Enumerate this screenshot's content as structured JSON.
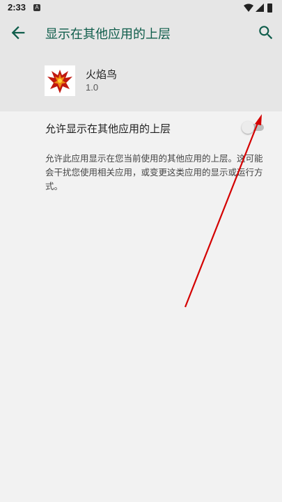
{
  "status_bar": {
    "time": "2:33",
    "notification_glyph": "A",
    "icons": [
      "wifi-icon",
      "signal-icon",
      "battery-icon"
    ]
  },
  "app_bar": {
    "title": "显示在其他应用的上层",
    "back_icon": "arrow-back-icon",
    "search_icon": "search-icon",
    "accent_color": "#0f5d4b"
  },
  "app_info": {
    "name": "火焰鸟",
    "version": "1.0",
    "icon": "phoenix-logo"
  },
  "permission": {
    "label": "允许显示在其他应用的上层",
    "enabled": false,
    "description": "允许此应用显示在您当前使用的其他应用的上层。这可能会干扰您使用相关应用，或变更这类应用的显示或运行方式。"
  },
  "annotation": {
    "color": "#d40000",
    "shape": "red-arrow"
  }
}
